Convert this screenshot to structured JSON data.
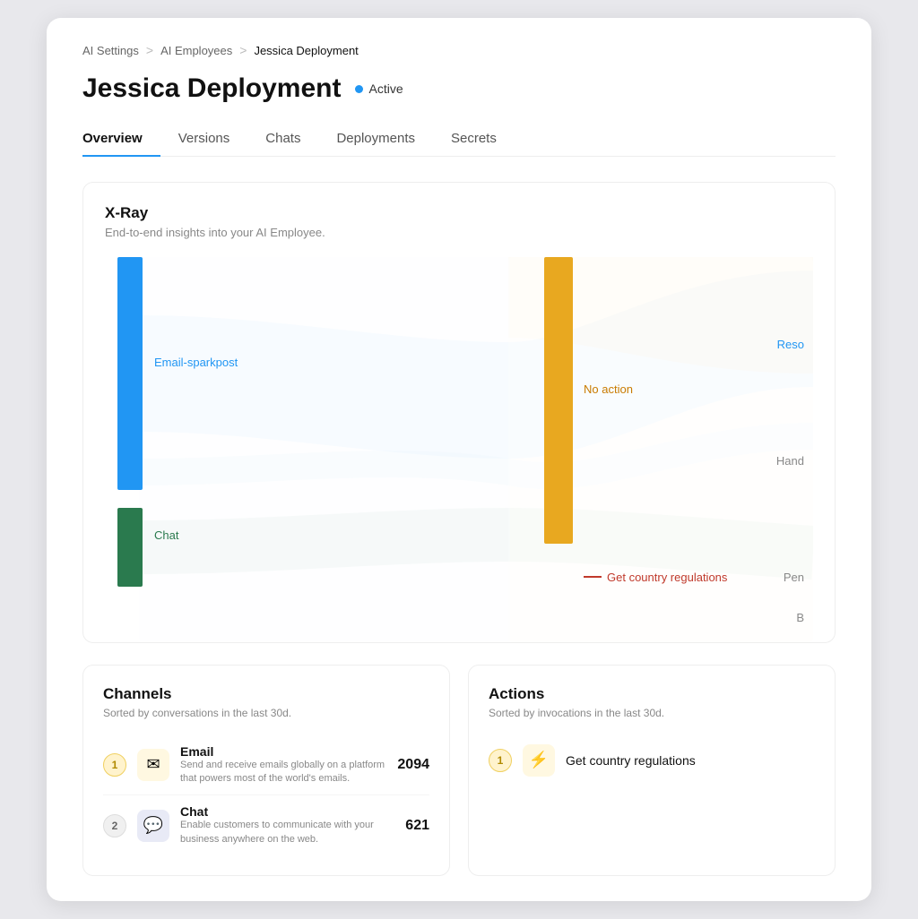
{
  "breadcrumb": {
    "items": [
      "AI Settings",
      "AI Employees",
      "Jessica Deployment"
    ],
    "separators": [
      ">",
      ">"
    ]
  },
  "page": {
    "title": "Jessica Deployment",
    "status": "Active"
  },
  "tabs": [
    {
      "label": "Overview",
      "active": true
    },
    {
      "label": "Versions",
      "active": false
    },
    {
      "label": "Chats",
      "active": false
    },
    {
      "label": "Deployments",
      "active": false
    },
    {
      "label": "Secrets",
      "active": false
    }
  ],
  "xray": {
    "title": "X-Ray",
    "subtitle": "End-to-end insights into your AI Employee.",
    "chart": {
      "labels": {
        "email": "Email-sparkpost",
        "chat": "Chat",
        "noaction": "No action",
        "getcountry": "Get country regulations",
        "reso": "Reso",
        "hand": "Hand",
        "pen": "Pen",
        "b": "B"
      }
    }
  },
  "channels": {
    "title": "Channels",
    "subtitle": "Sorted by conversations in the last 30d.",
    "items": [
      {
        "rank": "1",
        "name": "Email",
        "description": "Send and receive emails globally on a platform that powers most of the world's emails.",
        "count": "2094",
        "icon": "✉"
      },
      {
        "rank": "2",
        "name": "Chat",
        "description": "Enable customers to communicate with your business anywhere on the web.",
        "count": "621",
        "icon": "💬"
      }
    ]
  },
  "actions": {
    "title": "Actions",
    "subtitle": "Sorted by invocations in the last 30d.",
    "items": [
      {
        "rank": "1",
        "name": "Get country regulations",
        "icon": "⚡"
      }
    ]
  }
}
